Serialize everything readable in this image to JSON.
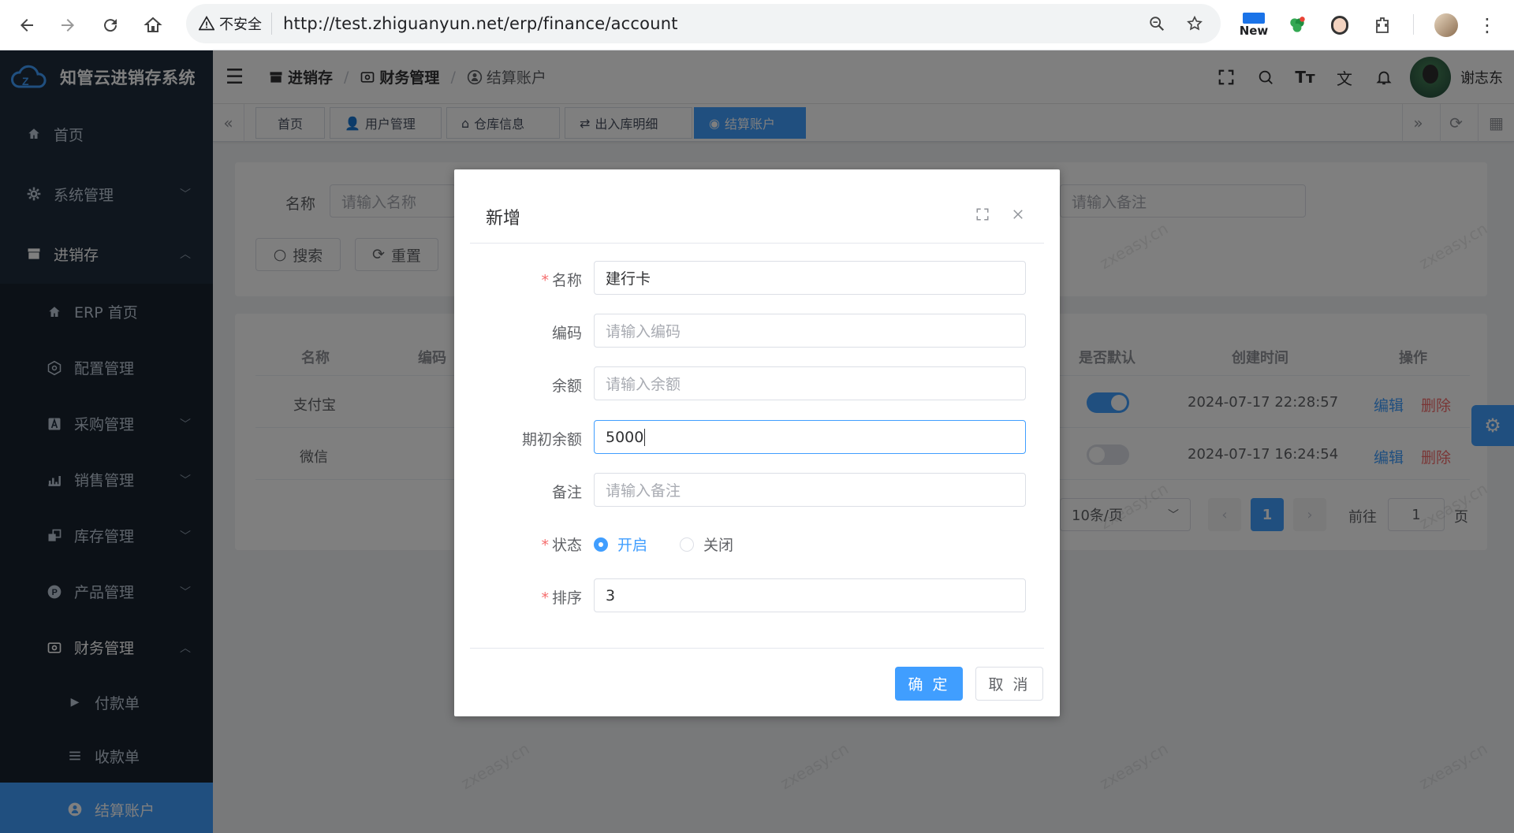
{
  "browser": {
    "security_label": "不安全",
    "url": "http://test.zhiguanyun.net/erp/finance/account",
    "new_badge": "New"
  },
  "app": {
    "title": "知管云进销存系统"
  },
  "sidebar": {
    "items": [
      {
        "label": "首页",
        "icon": "home-icon"
      },
      {
        "label": "系统管理",
        "icon": "gear-icon"
      },
      {
        "label": "进销存",
        "icon": "store-icon"
      }
    ],
    "erp_sub": [
      {
        "label": "ERP 首页",
        "icon": "home-icon"
      },
      {
        "label": "配置管理",
        "icon": "config-icon"
      },
      {
        "label": "采购管理",
        "icon": "purchase-icon"
      },
      {
        "label": "销售管理",
        "icon": "sales-icon"
      },
      {
        "label": "库存管理",
        "icon": "inventory-icon"
      },
      {
        "label": "产品管理",
        "icon": "product-icon"
      },
      {
        "label": "财务管理",
        "icon": "finance-icon"
      }
    ],
    "finance_sub": [
      {
        "label": "付款单",
        "icon": "caret-right-icon"
      },
      {
        "label": "收款单",
        "icon": "list-icon"
      },
      {
        "label": "结算账户",
        "icon": "account-icon"
      }
    ]
  },
  "breadcrumb": {
    "items": [
      "进销存",
      "财务管理",
      "结算账户"
    ]
  },
  "user": {
    "name": "谢志东"
  },
  "tags": [
    "首页",
    "用户管理",
    "仓库信息",
    "出入库明细",
    "结算账户"
  ],
  "search": {
    "name_label": "名称",
    "name_placeholder": "请输入名称",
    "remark_placeholder": "请输入备注",
    "search_btn": "搜索",
    "reset_btn": "重置"
  },
  "table": {
    "headers": [
      "名称",
      "编码",
      "是否默认",
      "创建时间",
      "操作"
    ],
    "rows": [
      {
        "name": "支付宝",
        "default": true,
        "created": "2024-07-17 22:28:57",
        "edit": "编辑",
        "delete": "删除"
      },
      {
        "name": "微信",
        "default": false,
        "created": "2024-07-17 16:24:54",
        "edit": "编辑",
        "delete": "删除"
      }
    ]
  },
  "pagination": {
    "page_size": "10条/页",
    "current_page": "1",
    "goto_label": "前往",
    "goto_value": "1",
    "page_suffix": "页"
  },
  "watermark": "zxeasy.cn",
  "dialog": {
    "title": "新增",
    "fields": {
      "name": {
        "label": "名称",
        "value": "建行卡",
        "required": true
      },
      "code": {
        "label": "编码",
        "placeholder": "请输入编码"
      },
      "balance": {
        "label": "余额",
        "placeholder": "请输入余额"
      },
      "initial_balance": {
        "label": "期初余额",
        "value": "5000"
      },
      "remark": {
        "label": "备注",
        "placeholder": "请输入备注"
      },
      "status": {
        "label": "状态",
        "options": [
          "开启",
          "关闭"
        ],
        "selected": "开启",
        "required": true
      },
      "sort": {
        "label": "排序",
        "value": "3",
        "required": true
      }
    },
    "confirm": "确 定",
    "cancel": "取 消"
  },
  "colors": {
    "primary": "#409eff",
    "danger": "#f56c6c",
    "sidebar_bg": "#1f2d3d"
  }
}
